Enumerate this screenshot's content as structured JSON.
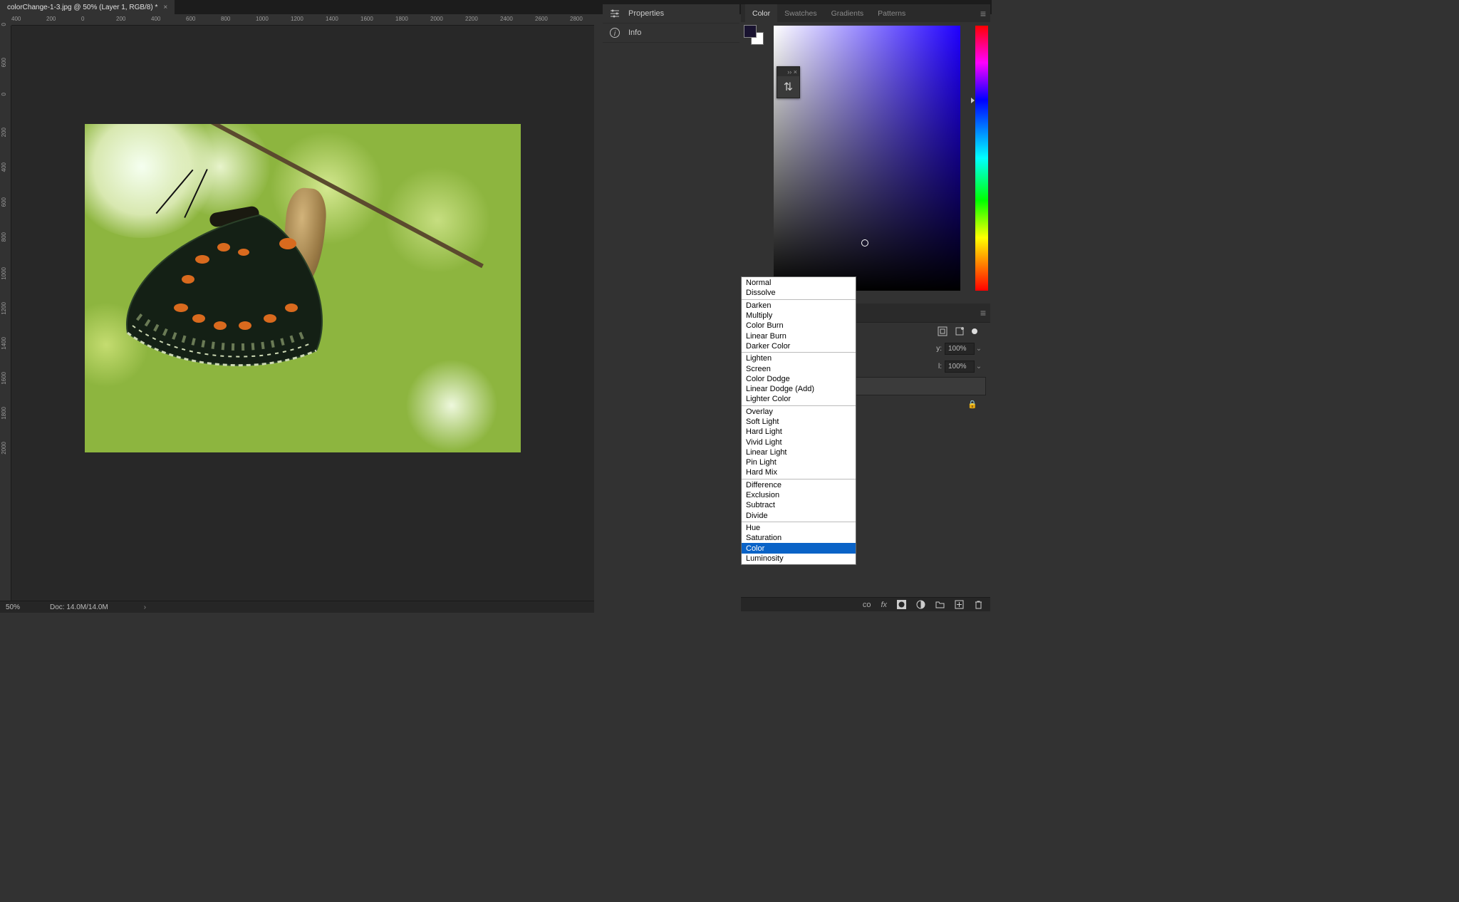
{
  "tab": {
    "title": "colorChange-1-3.jpg @ 50% (Layer 1, RGB/8) *",
    "close": "×"
  },
  "collapse_hint": "◄◄",
  "ruler_h": [
    "400",
    "200",
    "0",
    "200",
    "400",
    "600",
    "800",
    "1000",
    "1200",
    "1400",
    "1600",
    "1800",
    "2000",
    "2200",
    "2400",
    "2600",
    "2800"
  ],
  "ruler_v": [
    "0",
    "600",
    "0",
    "200",
    "400",
    "600",
    "800",
    "1000",
    "1200",
    "1400",
    "1600",
    "1800",
    "2000"
  ],
  "status": {
    "zoom": "50%",
    "docsize": "Doc: 14.0M/14.0M",
    "arrow": "›"
  },
  "mid_panel": [
    {
      "icon": "sliders",
      "label": "Properties"
    },
    {
      "icon": "info",
      "label": "Info"
    }
  ],
  "color_tabs": [
    "Color",
    "Swatches",
    "Gradients",
    "Patterns"
  ],
  "float_palette": {
    "collapse": "››",
    "close": "×",
    "glyph": "⇅"
  },
  "layers": {
    "opacity_label": "y:",
    "opacity_value": "100%",
    "fill_label": "l:",
    "fill_value": "100%",
    "lock": "🔒"
  },
  "blend_modes": [
    [
      "Normal",
      "Dissolve"
    ],
    [
      "Darken",
      "Multiply",
      "Color Burn",
      "Linear Burn",
      "Darker Color"
    ],
    [
      "Lighten",
      "Screen",
      "Color Dodge",
      "Linear Dodge (Add)",
      "Lighter Color"
    ],
    [
      "Overlay",
      "Soft Light",
      "Hard Light",
      "Vivid Light",
      "Linear Light",
      "Pin Light",
      "Hard Mix"
    ],
    [
      "Difference",
      "Exclusion",
      "Subtract",
      "Divide"
    ],
    [
      "Hue",
      "Saturation",
      "Color",
      "Luminosity"
    ]
  ],
  "blend_selected": "Color",
  "footer_icons": [
    "link",
    "fx",
    "mask",
    "adjust",
    "group",
    "new",
    "trash"
  ]
}
